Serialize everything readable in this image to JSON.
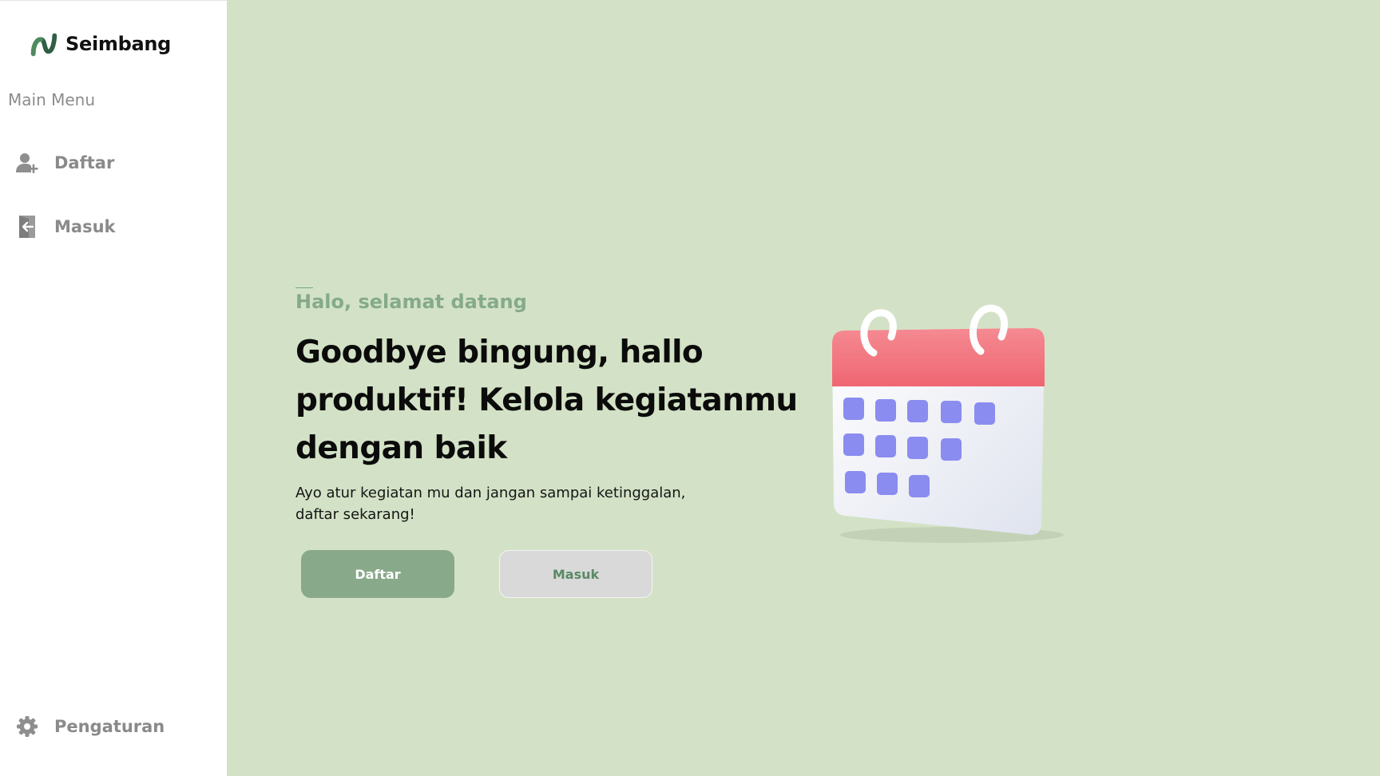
{
  "sidebar": {
    "brand_name": "Seimbang",
    "menu_heading": "Main Menu",
    "items": [
      {
        "label": "Daftar",
        "icon": "user-plus-icon"
      },
      {
        "label": "Masuk",
        "icon": "login-door-icon"
      }
    ],
    "settings": {
      "label": "Pengaturan",
      "icon": "gear-icon"
    }
  },
  "hero": {
    "eyebrow": "Halo, selamat datang",
    "headline": "Goodbye bingung, hallo produktif! Kelola kegiatanmu dengan baik",
    "subtext": "Ayo atur kegiatan mu  dan jangan sampai ketinggalan, daftar sekarang!",
    "primary_button": "Daftar",
    "secondary_button": "Masuk"
  },
  "illustration": {
    "icon": "calendar-icon"
  },
  "colors": {
    "main_bg": "#d3e2c6",
    "accent_green": "#88a98a",
    "eyebrow_green": "#85aa8b",
    "calendar_red": "#f2707a",
    "calendar_day": "#8a8cf0"
  }
}
